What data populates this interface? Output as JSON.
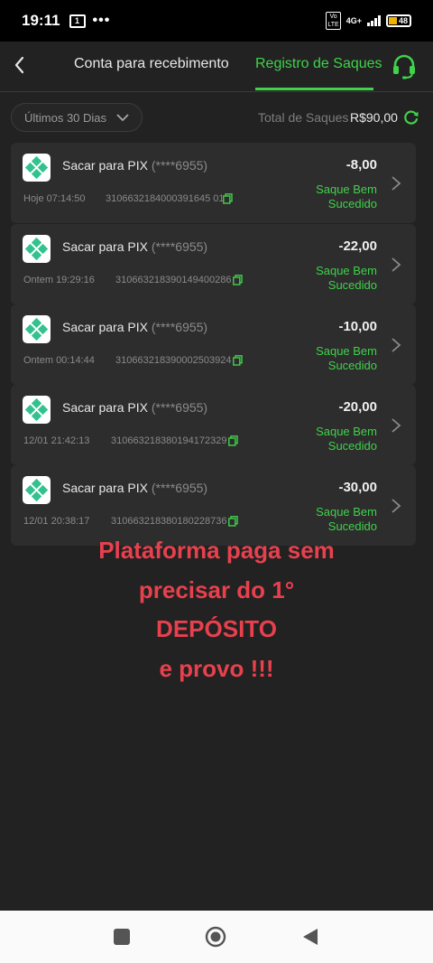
{
  "status_bar": {
    "time": "19:11",
    "notif_icon": "message-icon",
    "more": "•••",
    "volte": "Vo LTE",
    "network": "4G+",
    "battery": "48"
  },
  "header": {
    "back_icon": "arrow-left-icon",
    "tabs": [
      {
        "label": "Conta para recebimento",
        "active": false
      },
      {
        "label": "Registro de Saques",
        "active": true
      }
    ],
    "support_icon": "headset-icon"
  },
  "filter": {
    "label": "Últimos 30 Dias",
    "total_label": "Total de Saques",
    "total_value": "R$90,00"
  },
  "withdrawals": [
    {
      "title": "Sacar para PIX",
      "account": "(****6955)",
      "date": "Hoje 07:14:50",
      "id": "3106632184000391645 01",
      "amount": "-8,00",
      "status": "Saque Bem Sucedido"
    },
    {
      "title": "Sacar para PIX",
      "account": "(****6955)",
      "date": "Ontem 19:29:16",
      "id": "310663218390149400286",
      "amount": "-22,00",
      "status": "Saque Bem Sucedido"
    },
    {
      "title": "Sacar para PIX",
      "account": "(****6955)",
      "date": "Ontem 00:14:44",
      "id": "310663218390002503924",
      "amount": "-10,00",
      "status": "Saque Bem Sucedido"
    },
    {
      "title": "Sacar para PIX",
      "account": "(****6955)",
      "date": "12/01 21:42:13",
      "id": "310663218380194172329",
      "amount": "-20,00",
      "status": "Saque Bem Sucedido"
    },
    {
      "title": "Sacar para PIX",
      "account": "(****6955)",
      "date": "12/01 20:38:17",
      "id": "310663218380180228736",
      "amount": "-30,00",
      "status": "Saque Bem Sucedido"
    }
  ],
  "overlay": {
    "lines": [
      "Plataforma paga sem",
      "precisar do 1°",
      "DEPÓSITO",
      "e provo !!!"
    ],
    "color": "#e8404d"
  },
  "colors": {
    "accent": "#3fd24a",
    "background": "#222222",
    "card": "#2d2d2d"
  }
}
